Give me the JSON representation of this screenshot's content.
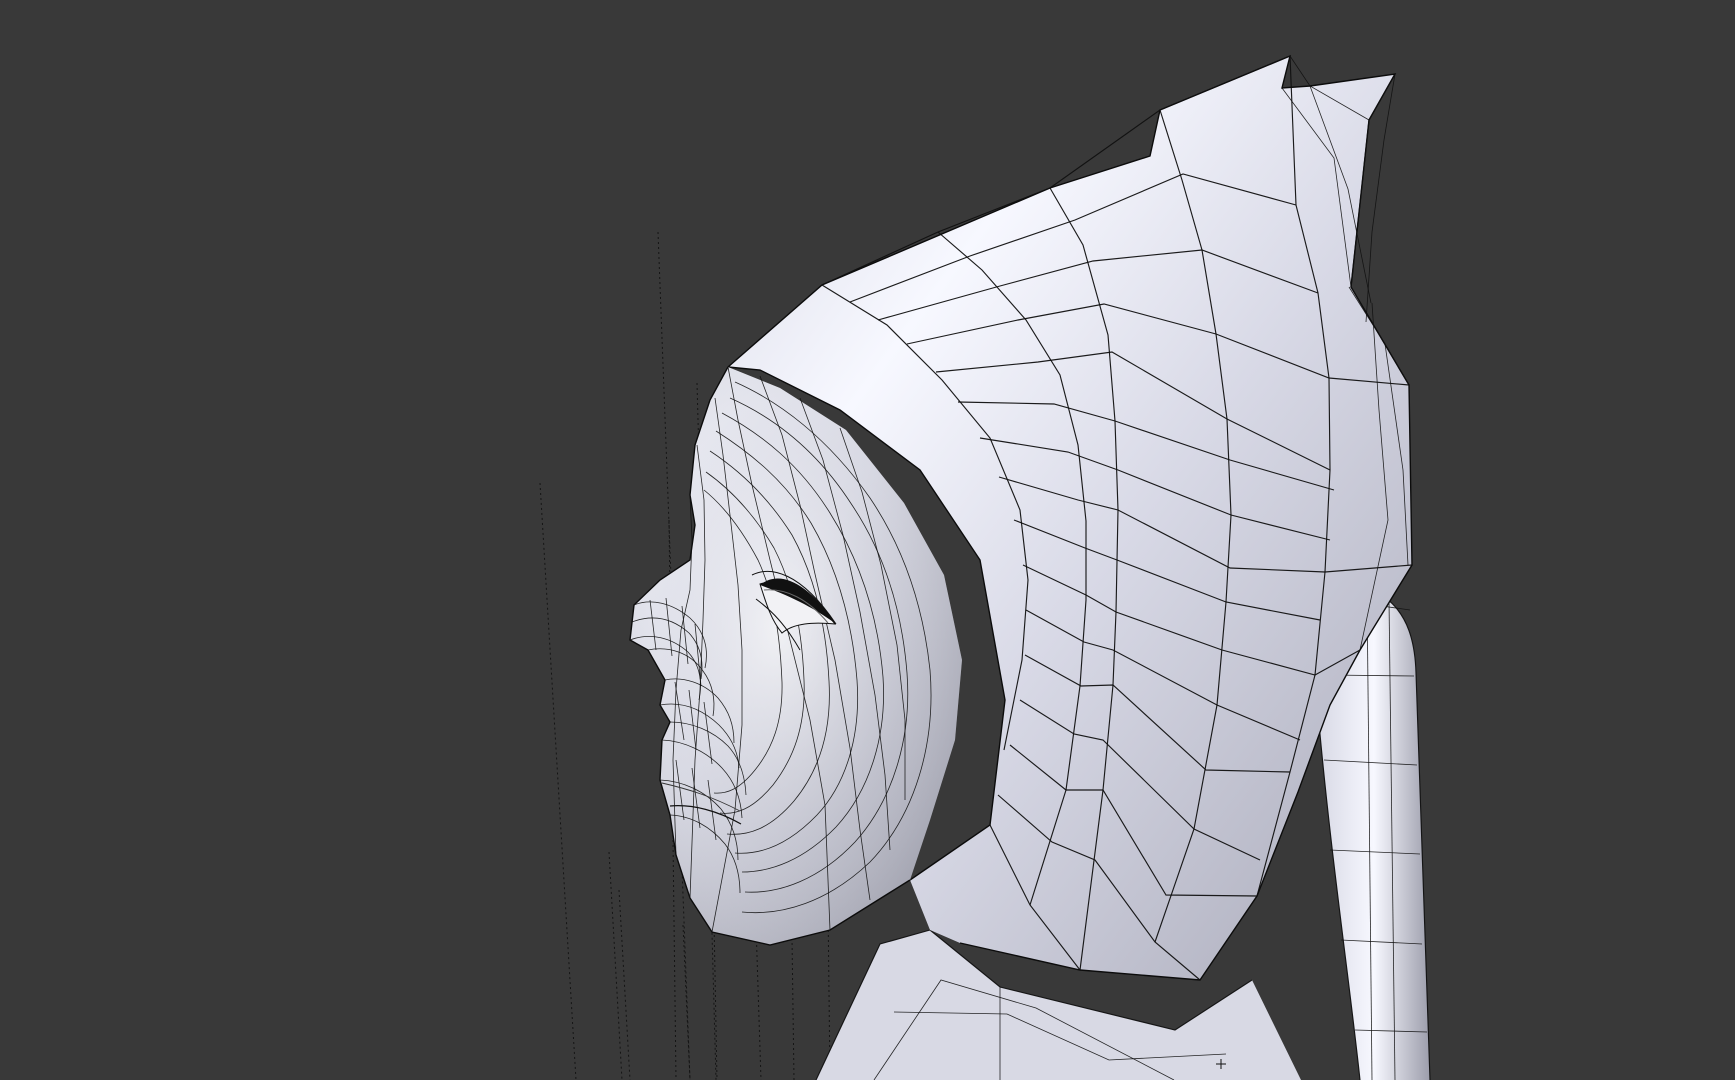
{
  "viewport": {
    "background": "#393939",
    "object": "head-mesh",
    "shading": "solid-with-wireframe",
    "mesh_color": "#e6e7f0"
  }
}
